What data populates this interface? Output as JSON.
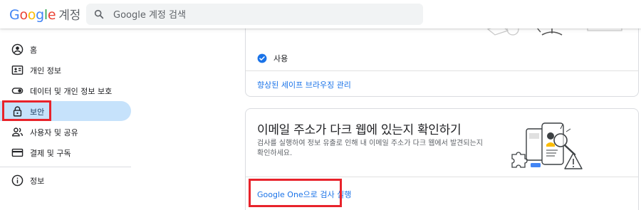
{
  "header": {
    "logo_google": "Google",
    "logo_product": "계정",
    "search_placeholder": "Google 계정 검색"
  },
  "sidebar": {
    "items": [
      {
        "label": "홈",
        "icon": "account-circle-icon"
      },
      {
        "label": "개인 정보",
        "icon": "id-card-icon"
      },
      {
        "label": "데이터 및 개인 정보 보호",
        "icon": "toggle-icon"
      },
      {
        "label": "보안",
        "icon": "lock-icon",
        "active": true
      },
      {
        "label": "사용자 및 공유",
        "icon": "people-icon"
      },
      {
        "label": "결제 및 구독",
        "icon": "credit-card-icon"
      },
      {
        "label": "정보",
        "icon": "info-icon"
      }
    ]
  },
  "safe_browsing": {
    "status": "사용",
    "link": "향상된 세이프 브라우징 관리"
  },
  "dark_web": {
    "title": "이메일 주소가 다크 웹에 있는지 확인하기",
    "description": "검사를 실행하여 정보 유출로 인해 내 이메일 주소가 다크 웹에서 발견되는지 확인하세요.",
    "link": "Google One으로 검사 실행"
  },
  "colors": {
    "accent": "#1a73e8",
    "active_nav": "#c6e2fb",
    "highlight": "#e8232b"
  }
}
